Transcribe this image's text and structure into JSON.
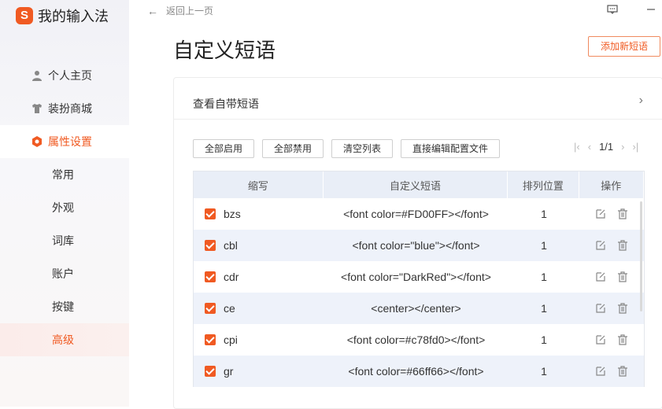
{
  "app": {
    "logo_char": "S",
    "name": "我的输入法"
  },
  "sidebar": {
    "items": [
      {
        "label": "个人主页",
        "icon": "person-icon"
      },
      {
        "label": "装扮商城",
        "icon": "shirt-icon"
      },
      {
        "label": "属性设置",
        "icon": "settings-hex-icon"
      }
    ],
    "subitems": [
      {
        "label": "常用"
      },
      {
        "label": "外观"
      },
      {
        "label": "词库"
      },
      {
        "label": "账户"
      },
      {
        "label": "按键"
      },
      {
        "label": "高级"
      }
    ]
  },
  "header": {
    "back_label": "返回上一页"
  },
  "page": {
    "title": "自定义短语",
    "add_button": "添加新短语"
  },
  "builtin": {
    "label": "查看自带短语"
  },
  "actions": {
    "enable_all": "全部启用",
    "disable_all": "全部禁用",
    "clear_list": "清空列表",
    "edit_config": "直接编辑配置文件"
  },
  "pager": {
    "text": "1/1"
  },
  "table": {
    "headers": [
      "缩写",
      "自定义短语",
      "排列位置",
      "操作"
    ],
    "rows": [
      {
        "abbr": "bzs",
        "phrase": "<font color=#FD00FF></font>",
        "position": "1"
      },
      {
        "abbr": "cbl",
        "phrase": "<font color=\"blue\"></font>",
        "position": "1"
      },
      {
        "abbr": "cdr",
        "phrase": "<font color=\"DarkRed\"></font>",
        "position": "1"
      },
      {
        "abbr": "ce",
        "phrase": "<center></center>",
        "position": "1"
      },
      {
        "abbr": "cpi",
        "phrase": "<font color=#c78fd0></font>",
        "position": "1"
      },
      {
        "abbr": "gr",
        "phrase": "<font color=#66ff66></font>",
        "position": "1"
      }
    ]
  },
  "colors": {
    "accent": "#f05a22",
    "header_bg": "#e9eef7",
    "stripe": "#eef2fa"
  }
}
